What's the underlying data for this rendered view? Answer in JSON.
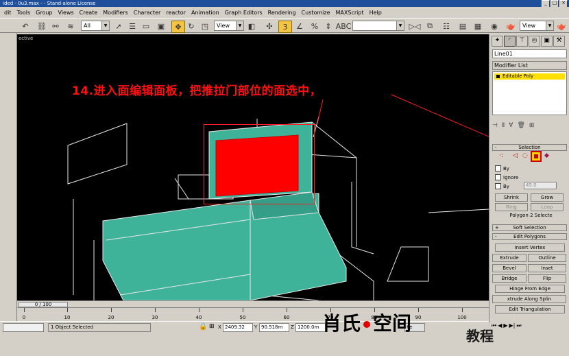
{
  "window": {
    "title": "ided - 0u3.max - - Stand-alone License"
  },
  "menu": [
    "dit",
    "Tools",
    "Group",
    "Views",
    "Create",
    "Modifiers",
    "Character",
    "reactor",
    "Animation",
    "Graph Editors",
    "Rendering",
    "Customize",
    "MAXScript",
    "Help"
  ],
  "toolbar": {
    "selection_filter": "All",
    "ref_coord": "View",
    "named_sel": "",
    "view_right": "View"
  },
  "viewport": {
    "label": "ective",
    "annotation": "14.进入面编辑面板，把推拉门部位的面选中，",
    "colors": {
      "mesh": "#3fb39a",
      "selected": "#ff0000",
      "annotation": "#ff1010"
    }
  },
  "command_panel": {
    "object_name": "Line01",
    "modifier_list_label": "Modifier List",
    "modifier_stack": [
      "Editable Poly"
    ],
    "selection": {
      "title": "Selection",
      "by_vertex": "By",
      "ignore_backfacing": "Ignore",
      "by_angle": "By",
      "angle_value": "45.0",
      "shrink": "Shrink",
      "grow": "Grow",
      "ring": "Ring",
      "loop": "Loop",
      "status": "Polygon 2 Selecte"
    },
    "soft_selection": "Soft Selection",
    "edit_polygons": {
      "title": "Edit Polygons",
      "insert_vertex": "Insert Vertex",
      "extrude": "Extrude",
      "outline": "Outline",
      "bevel": "Bevel",
      "inset": "Inset",
      "bridge": "Bridge",
      "flip": "Flip",
      "hinge": "Hinge From Edge",
      "extrude_spline": "xtrude Along Splin",
      "edit_tri": "Edit Triangulation"
    }
  },
  "timeline": {
    "slider": "0 / 100",
    "ticks": [
      "0",
      "10",
      "20",
      "30",
      "40",
      "50",
      "60",
      "70",
      "80",
      "90",
      "100"
    ]
  },
  "status": {
    "selected_text": "1 Object Selected",
    "x_label": "X",
    "x_value": "2409.32",
    "y_label": "Y",
    "y_value": "90.518m",
    "z_label": "Z",
    "z_value": "1200.0m",
    "key_label": "Ke"
  },
  "watermark": {
    "text_left": "肖氏",
    "text_right": "空间",
    "text_sub": "教程"
  }
}
